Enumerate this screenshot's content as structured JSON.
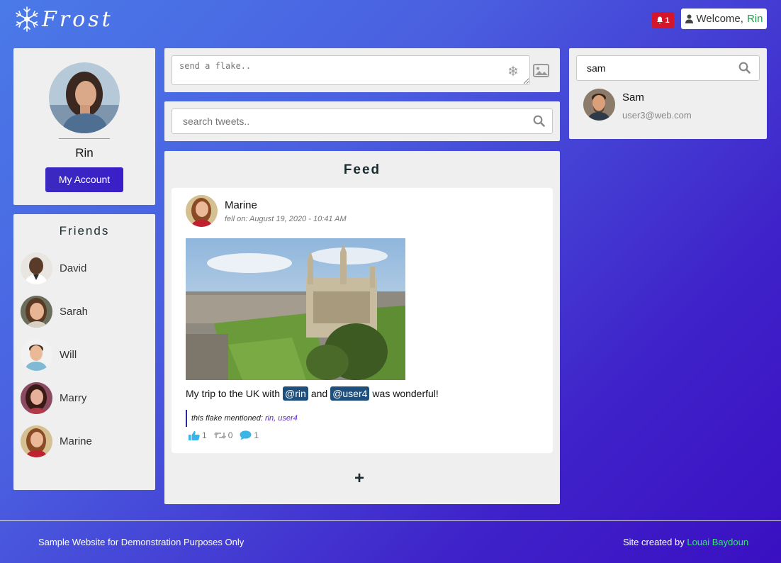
{
  "brand": {
    "name": "Frost"
  },
  "header": {
    "notifications_count": "1",
    "welcome_prefix": "Welcome,",
    "welcome_user": "Rin"
  },
  "profile": {
    "name": "Rin",
    "account_button": "My Account"
  },
  "friends": {
    "title": "Friends",
    "items": [
      {
        "name": "David"
      },
      {
        "name": "Sarah"
      },
      {
        "name": "Will"
      },
      {
        "name": "Marry"
      },
      {
        "name": "Marine"
      }
    ]
  },
  "compose": {
    "placeholder": "send a flake.."
  },
  "search_tweets": {
    "placeholder": "search tweets.."
  },
  "feed": {
    "title": "Feed",
    "posts": [
      {
        "author": "Marine",
        "meta": "fell on: August 19, 2020 - 10:41 AM",
        "text_before": "My trip to the UK with",
        "tag1": "@rin",
        "text_mid": "and",
        "tag2": "@user4",
        "text_after": "was wonderful!",
        "mention_prefix": "this flake mentioned:",
        "mention_users": "rin, user4",
        "likes": "1",
        "reflakes": "0",
        "comments": "1"
      }
    ],
    "add_label": "+"
  },
  "user_search": {
    "query": "sam",
    "results": [
      {
        "name": "Sam",
        "email": "user3@web.com"
      }
    ]
  },
  "footer": {
    "left": "Sample Website for Demonstration Purposes Only",
    "right_prefix": "Site created by",
    "right_author": "Louai Baydoun"
  },
  "colors": {
    "notification_badge": "#d5152a",
    "welcome_user": "#1e9e4a",
    "tag_bg": "#1f4f7c",
    "footer_author": "#3ee07a",
    "action_icons": "#3cb4e6"
  }
}
